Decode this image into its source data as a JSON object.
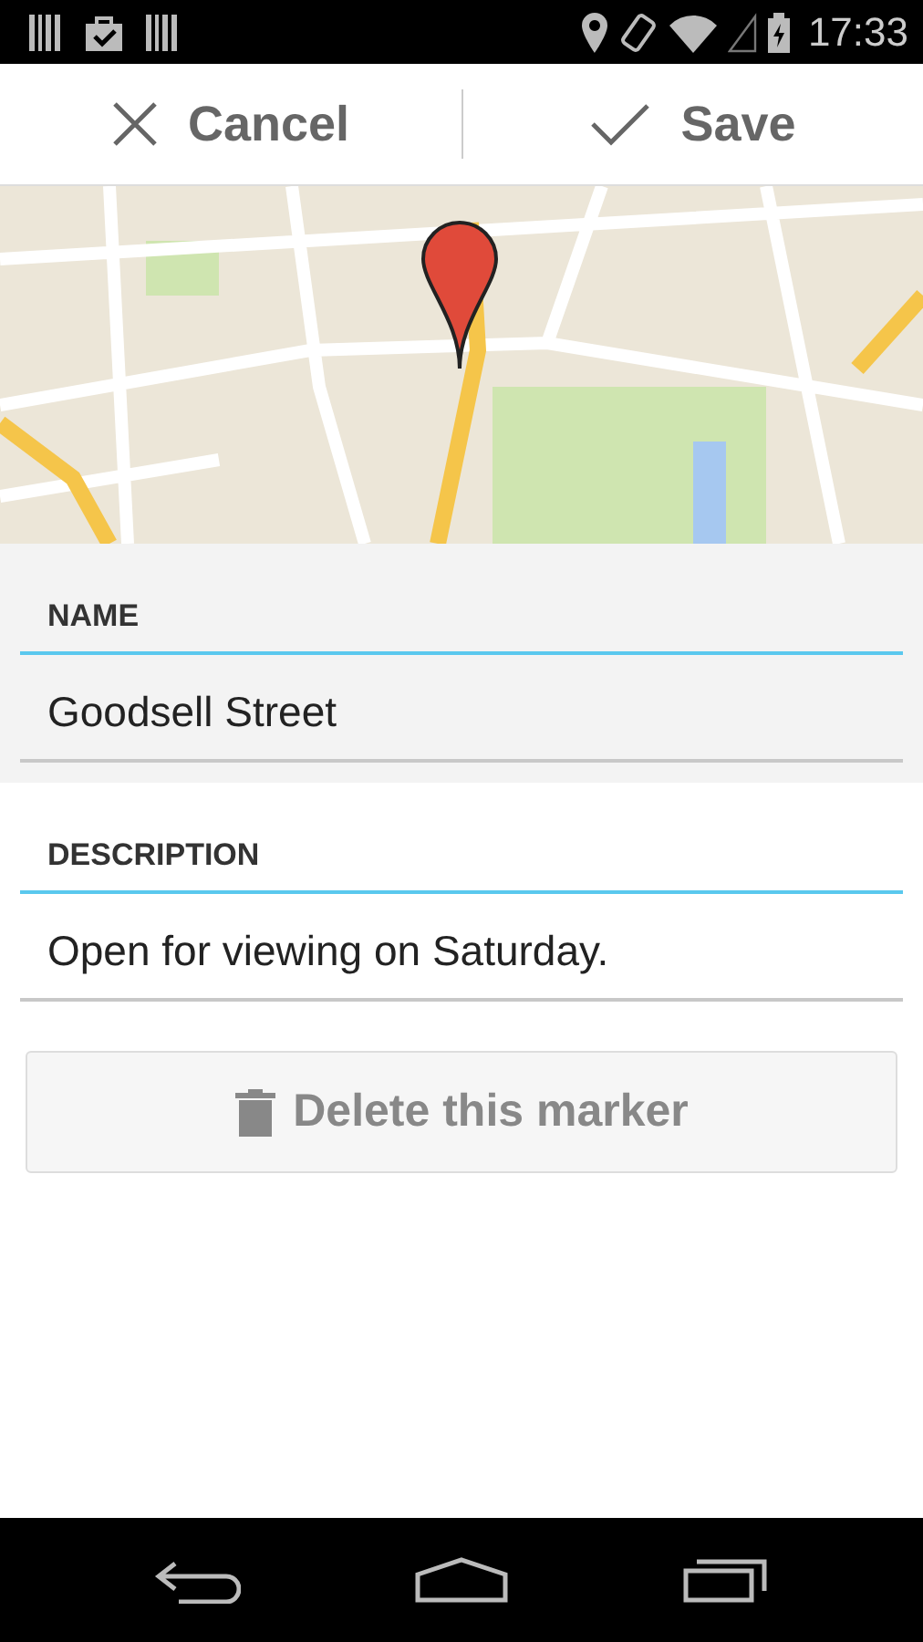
{
  "status_bar": {
    "time": "17:33"
  },
  "action_bar": {
    "buttons": [
      {
        "kind": "cancel",
        "label": "Cancel"
      },
      {
        "kind": "save",
        "label": "Save"
      }
    ]
  },
  "fields": [
    {
      "label": "NAME",
      "value": "Goodsell Street",
      "focused": true
    },
    {
      "label": "DESCRIPTION",
      "value": "Open for viewing on Saturday.",
      "focused": false
    }
  ],
  "delete_button": {
    "label": "Delete this marker",
    "disabled": true
  }
}
